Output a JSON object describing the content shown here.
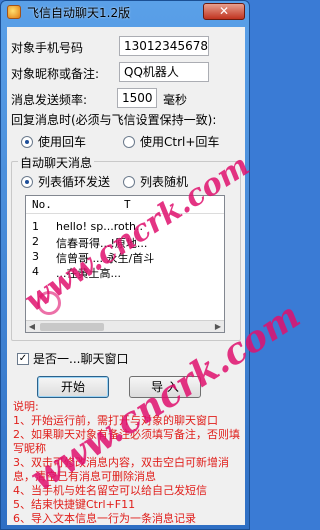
{
  "window": {
    "title": "飞信自动聊天1.2版",
    "close_glyph": "✕"
  },
  "form": {
    "phone_label": "对象手机号码",
    "phone_value": "13012345678",
    "nickname_label": "对象昵称或备注:",
    "nickname_value": "QQ机器人",
    "interval_label": "消息发送频率:",
    "interval_value": "1500",
    "interval_unit": "毫秒",
    "enter_mode_label": "回复消息时(必须与飞信设置保持一致):",
    "enter_options": [
      {
        "label": "使用回车",
        "selected": true
      },
      {
        "label": "使用Ctrl+回车",
        "selected": false
      }
    ]
  },
  "auto_group": {
    "title": "自动聊天消息",
    "mode_options": [
      {
        "label": "列表循环发送",
        "selected": true
      },
      {
        "label": "列表随机",
        "selected": false
      }
    ],
    "list": {
      "col_no": "No.",
      "col_text": "T",
      "rows": [
        {
          "no": "1",
          "text": "hello! sp...roth.."
        },
        {
          "no": "2",
          "text": "信春哥得...!原地..."
        },
        {
          "no": "3",
          "text": "信曾哥 ... 永生/首斗"
        },
        {
          "no": "4",
          "text": "...在黄土高..."
        }
      ]
    }
  },
  "topmost": {
    "checked": true,
    "label": "是否一...聊天窗口"
  },
  "buttons": {
    "start": "开始",
    "import": "导  入"
  },
  "notes": {
    "heading": "说明:",
    "items": [
      "1、开始运行前，需打开与对象的聊天窗口",
      "2、如果聊天对象有备注必须填写备注，否则填写昵称",
      "3、双击可修改消息内容，双击空白可新增消息，清空已有消息可删除消息",
      "4、当手机与姓名留空可以给自己发短信",
      "5、结束快捷键Ctrl+F11",
      "6、导入文本信息一行为一条消息记录"
    ]
  },
  "watermark": {
    "text": "www.cncrk.com"
  }
}
